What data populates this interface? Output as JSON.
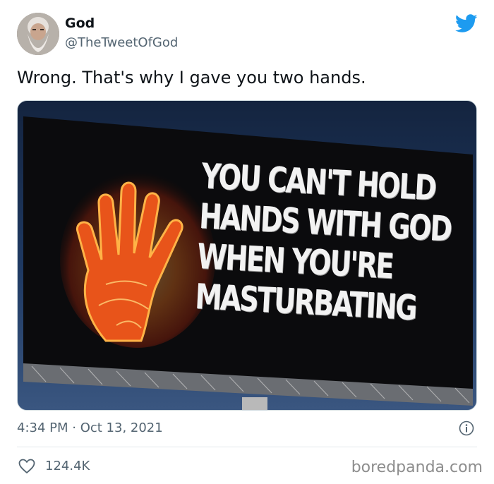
{
  "author": {
    "display_name": "God",
    "handle": "@TheTweetOfGod",
    "avatar_icon": "bearded-man-avatar"
  },
  "brand": {
    "icon": "twitter-bird-icon",
    "color": "#1d9bf0"
  },
  "tweet": {
    "text": "Wrong. That's why I gave you two hands.",
    "timestamp": "4:34 PM · Oct 13, 2021",
    "likes": "124.4K"
  },
  "media": {
    "billboard_lines": [
      "YOU CAN'T HOLD",
      "HANDS WITH GOD",
      "WHEN YOU'RE",
      "MASTURBATING"
    ],
    "hand_icon": "flaming-hand-icon"
  },
  "footer": {
    "info_icon": "info-icon",
    "like_icon": "heart-icon",
    "watermark": "boredpanda.com"
  }
}
